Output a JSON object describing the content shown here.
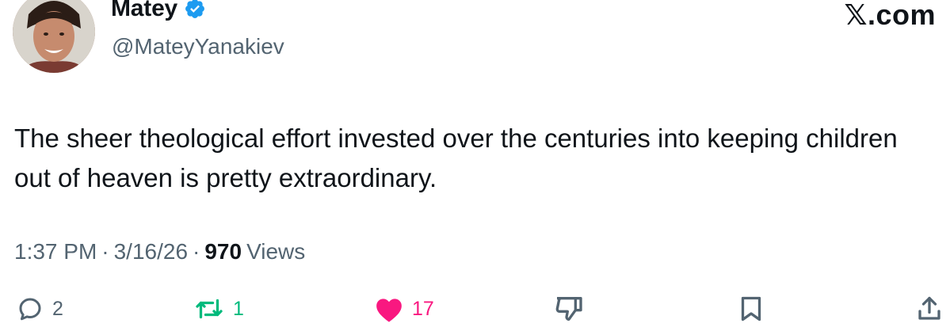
{
  "author": {
    "display_name": "Matey",
    "handle": "@MateyYanakiev",
    "verified_icon": "verified-badge-icon",
    "avatar_icon": "profile-photo"
  },
  "brand": {
    "label": "𝕏.com"
  },
  "tweet": {
    "text": "The sheer theological effort invested over the centuries into keeping children out of heaven is pretty extraordinary."
  },
  "meta": {
    "time": "1:37 PM",
    "separator": "·",
    "date": "3/16/26",
    "views_count": "970",
    "views_label": "Views"
  },
  "actions": {
    "reply": {
      "icon": "reply-icon",
      "count": "2"
    },
    "repost": {
      "icon": "repost-icon",
      "count": "1"
    },
    "like": {
      "icon": "heart-icon",
      "count": "17"
    },
    "dislike": {
      "icon": "dislike-icon"
    },
    "bookmark": {
      "icon": "bookmark-icon"
    },
    "share": {
      "icon": "share-icon"
    }
  },
  "colors": {
    "text_primary": "#0f1419",
    "text_secondary": "#536471",
    "verified_blue": "#1d9bf0",
    "repost_green": "#00ba7c",
    "like_pink": "#f91880"
  }
}
